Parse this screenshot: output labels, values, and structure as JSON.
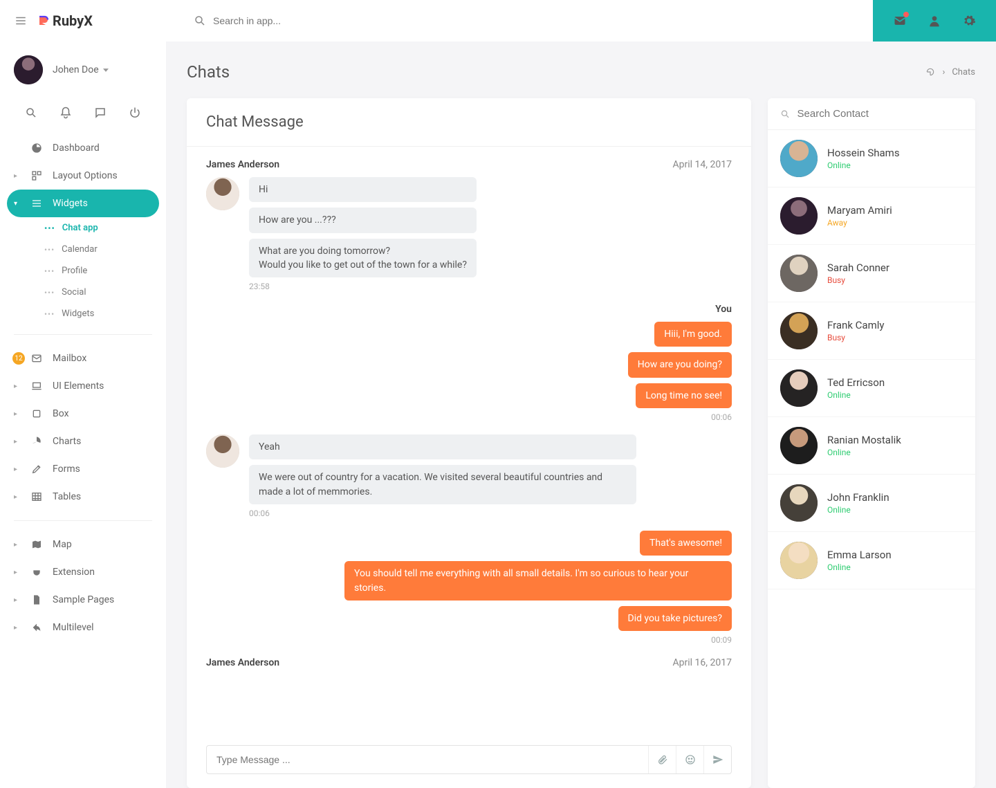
{
  "brand": {
    "name": "RubyX"
  },
  "topbar": {
    "search_placeholder": "Search in app...",
    "icons": {
      "mail": "mail",
      "user": "user",
      "gear": "settings"
    }
  },
  "user": {
    "name": "Johen Doe"
  },
  "quick": [
    "search",
    "bell",
    "chat",
    "power"
  ],
  "nav": {
    "dashboard": "Dashboard",
    "layout": "Layout Options",
    "widgets": "Widgets",
    "widgets_sub": {
      "chat": "Chat app",
      "calendar": "Calendar",
      "profile": "Profile",
      "social": "Social",
      "widgets": "Widgets"
    },
    "mailbox": "Mailbox",
    "mailbox_badge": "12",
    "ui": "UI Elements",
    "box": "Box",
    "charts": "Charts",
    "forms": "Forms",
    "tables": "Tables",
    "map": "Map",
    "extension": "Extension",
    "sample": "Sample Pages",
    "multilevel": "Multilevel"
  },
  "page": {
    "title": "Chats",
    "breadcrumb": {
      "home": "home",
      "current": "Chats"
    }
  },
  "chat": {
    "panel_title": "Chat Message",
    "groups": [
      {
        "who": "James Anderson",
        "when": "April 14, 2017",
        "side": "left",
        "bubbles": [
          "Hi",
          "How are you ...???",
          "What are you doing tomorrow?\nWould you like to get out of the town for a while?"
        ],
        "time": "23:58"
      },
      {
        "who": "You",
        "when": "",
        "side": "right",
        "bubbles": [
          "Hiii, I'm good.",
          "How are you doing?",
          "Long time no see!"
        ],
        "time": "00:06"
      },
      {
        "who_hidden": true,
        "who": "James Anderson",
        "when": "",
        "side": "left",
        "bubbles": [
          "Yeah",
          "We were out of country for a vacation. We visited several beautiful countries and made a lot of memmories."
        ],
        "time": "00:06"
      },
      {
        "who_hidden": true,
        "who": "You",
        "when": "",
        "side": "right",
        "bubbles": [
          "That's awesome!",
          "You should tell me everything with all small details. I'm so curious to hear your stories.",
          "Did you take pictures?"
        ],
        "time": "00:09"
      },
      {
        "who": "James Anderson",
        "when": "April 16, 2017",
        "side": "left",
        "bubbles": [],
        "time": ""
      }
    ],
    "compose_placeholder": "Type Message ..."
  },
  "contacts": {
    "search_placeholder": "Search Contact",
    "list": [
      {
        "name": "Hossein Shams",
        "status": "Online",
        "status_class": "online",
        "av": "av-1"
      },
      {
        "name": "Maryam Amiri",
        "status": "Away",
        "status_class": "away",
        "av": "av-2"
      },
      {
        "name": "Sarah Conner",
        "status": "Busy",
        "status_class": "busy",
        "av": "av-3"
      },
      {
        "name": "Frank Camly",
        "status": "Busy",
        "status_class": "busy",
        "av": "av-4"
      },
      {
        "name": "Ted Erricson",
        "status": "Online",
        "status_class": "online",
        "av": "av-5"
      },
      {
        "name": "Ranian Mostalik",
        "status": "Online",
        "status_class": "online",
        "av": "av-6"
      },
      {
        "name": "John Franklin",
        "status": "Online",
        "status_class": "online",
        "av": "av-7"
      },
      {
        "name": "Emma Larson",
        "status": "Online",
        "status_class": "online",
        "av": "av-8"
      }
    ]
  }
}
